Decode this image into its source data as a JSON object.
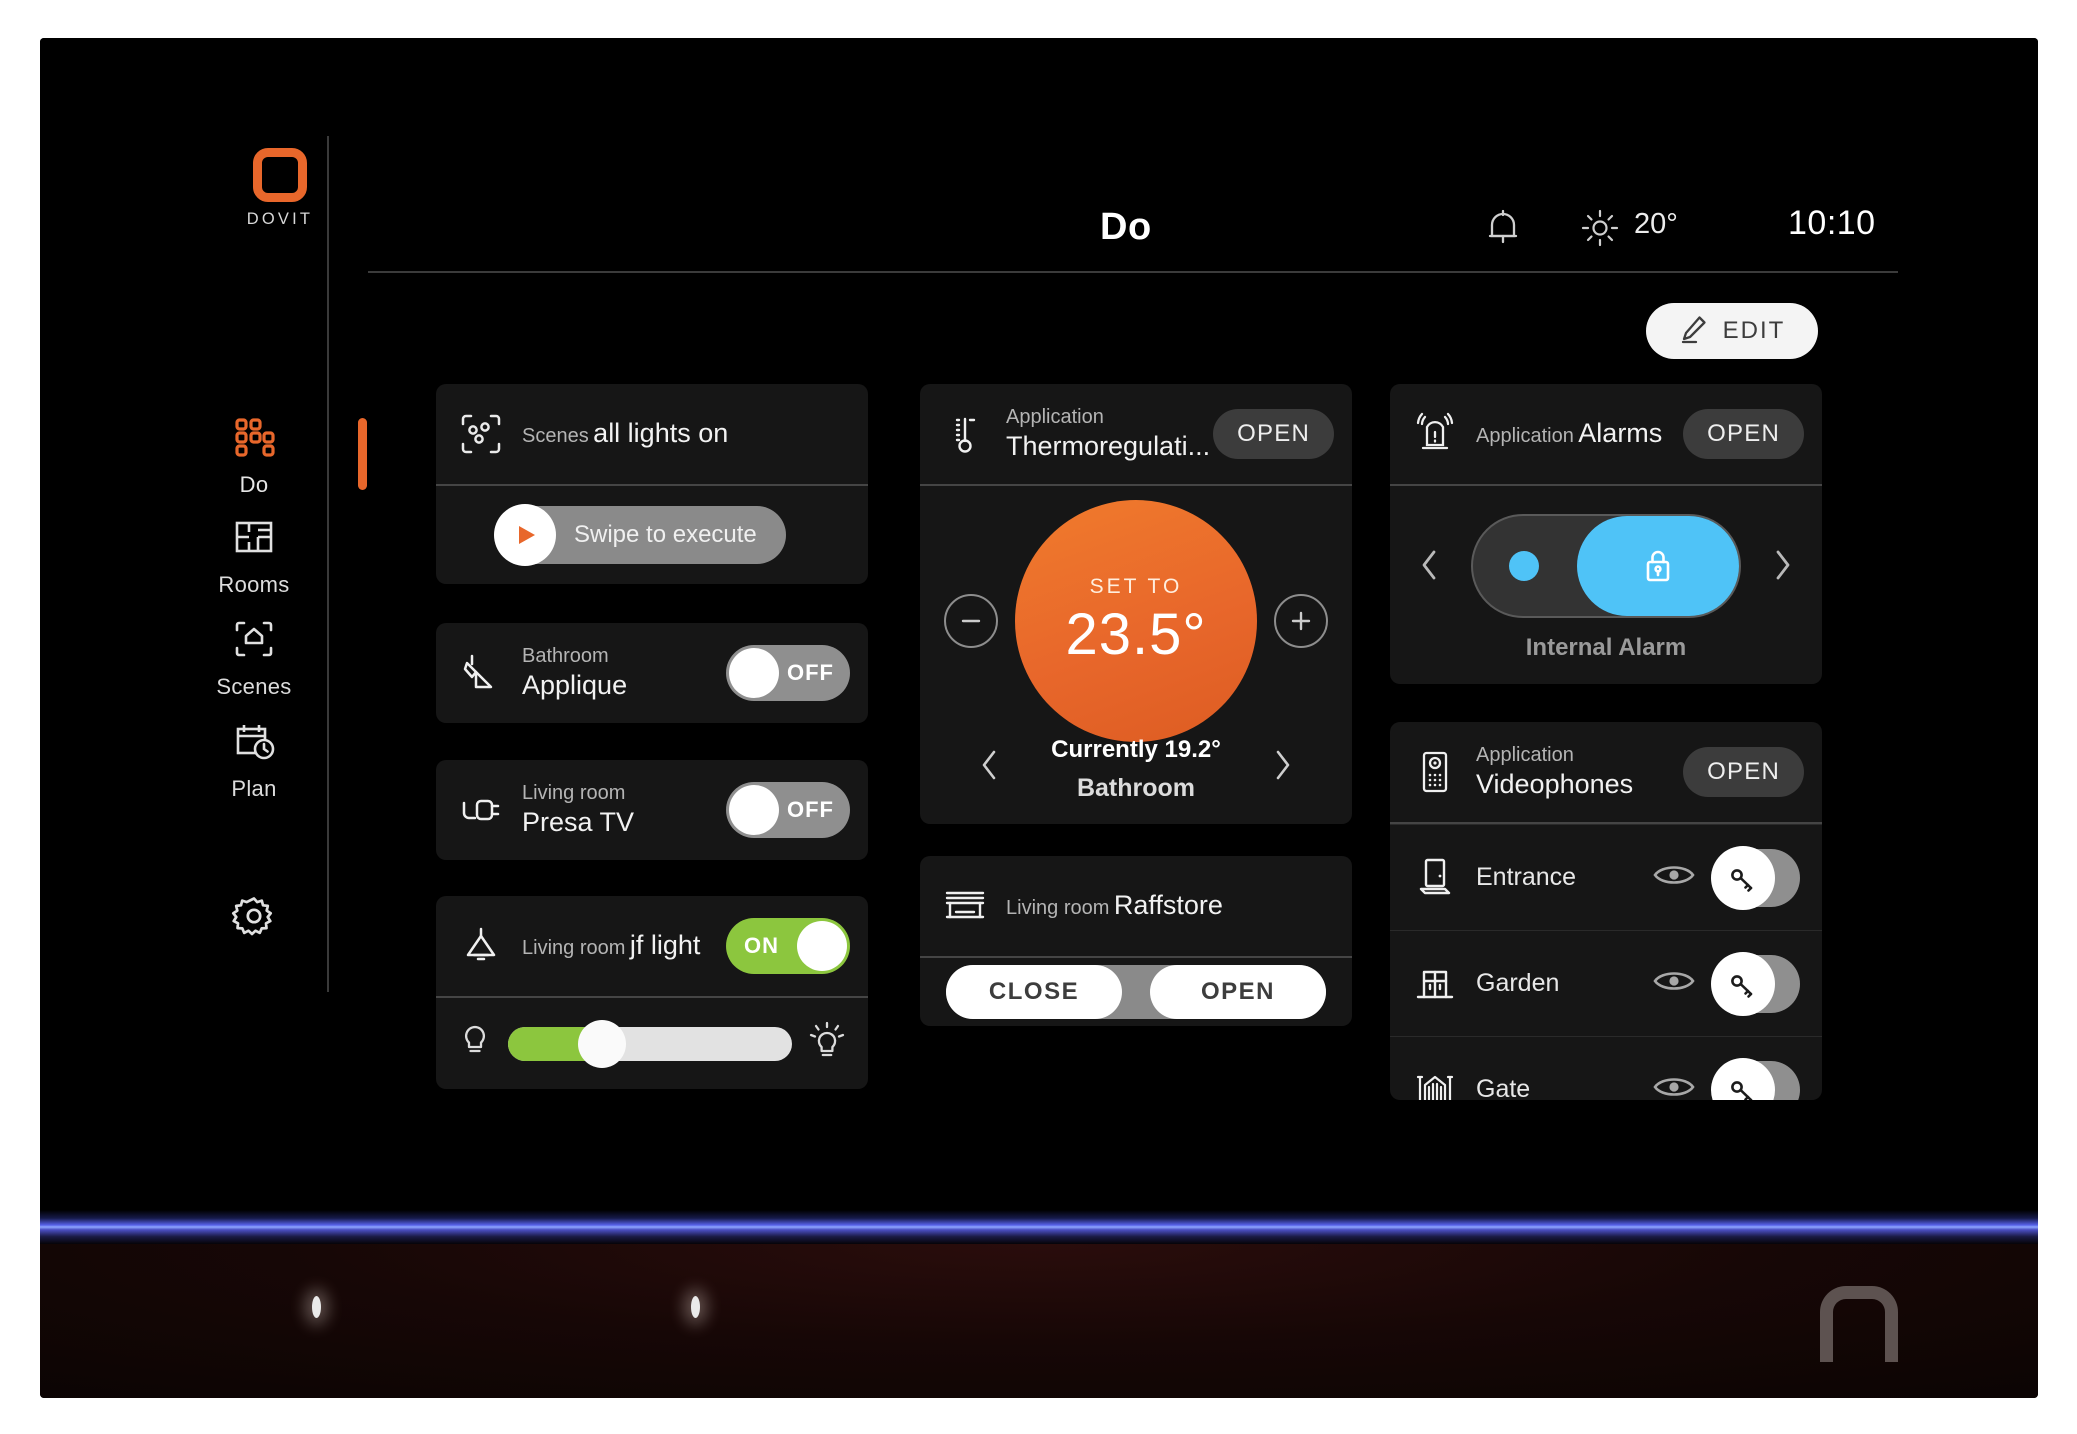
{
  "header": {
    "title": "Do",
    "bell_icon": "bell-icon",
    "weather_icon": "sun-icon",
    "outdoor_temp": "20°",
    "clock": "10:10"
  },
  "logo": {
    "text": "DOVIT",
    "color": "#E8672B"
  },
  "sidebar": {
    "items": [
      {
        "label": "Do",
        "icon": "grid-icon",
        "active": true
      },
      {
        "label": "Rooms",
        "icon": "floorplan-icon",
        "active": false
      },
      {
        "label": "Scenes",
        "icon": "home-frame-icon",
        "active": false
      },
      {
        "label": "Plan",
        "icon": "calendar-clock-icon",
        "active": false
      }
    ],
    "settings": {
      "label": "",
      "icon": "gear-icon"
    }
  },
  "toolbar": {
    "edit_label": "EDIT",
    "edit_icon": "pencil-icon"
  },
  "cards": {
    "scenes": {
      "icon": "scene-scan-icon",
      "subtitle": "Scenes",
      "name": "all lights on",
      "swipe_label": "Swipe to execute",
      "swipe_icon": "play-icon"
    },
    "applique": {
      "icon": "wall-lamp-icon",
      "subtitle": "Bathroom",
      "name": "Applique",
      "toggle_state": "OFF"
    },
    "presa_tv": {
      "icon": "plug-icon",
      "subtitle": "Living room",
      "name": "Presa TV",
      "toggle_state": "OFF"
    },
    "jf_light": {
      "icon": "pendant-lamp-icon",
      "subtitle": "Living room",
      "name": "jf light",
      "toggle_state": "ON",
      "dimmer_percent": 33,
      "dim_icon": "bulb-dim-icon",
      "bright_icon": "bulb-bright-icon"
    },
    "thermoregulation": {
      "icon": "thermometer-icon",
      "subtitle": "Application",
      "name": "Thermoregulati...",
      "open_label": "OPEN",
      "set_label": "SET TO",
      "setpoint": "23.5°",
      "current": "Currently 19.2°",
      "zone": "Bathroom",
      "minus_icon": "minus-circle-icon",
      "plus_icon": "plus-circle-icon",
      "prev_icon": "chevron-left-icon",
      "next_icon": "chevron-right-icon"
    },
    "raffstore": {
      "icon": "blind-icon",
      "subtitle": "Living room",
      "name": "Raffstore",
      "close_label": "CLOSE",
      "open_label": "OPEN"
    },
    "alarms": {
      "icon": "siren-icon",
      "subtitle": "Application",
      "name": "Alarms",
      "open_label": "OPEN",
      "zone_label": "Internal Alarm",
      "lock_icon": "lock-icon",
      "prev_icon": "chevron-left-icon",
      "next_icon": "chevron-right-icon",
      "accent": "#4FC3F7"
    },
    "videophones": {
      "icon": "intercom-icon",
      "subtitle": "Application",
      "name": "Videophones",
      "open_label": "OPEN",
      "rows": [
        {
          "name": "Entrance",
          "icon": "door-icon",
          "eye_icon": "eye-icon",
          "key_icon": "key-icon"
        },
        {
          "name": "Garden",
          "icon": "garden-gate-icon",
          "eye_icon": "eye-icon",
          "key_icon": "key-icon"
        },
        {
          "name": "Gate",
          "icon": "fence-gate-icon",
          "eye_icon": "eye-icon",
          "key_icon": "key-icon"
        }
      ]
    }
  },
  "colors": {
    "accent_orange": "#E8672B",
    "toggle_on_green": "#8CC63E",
    "alarm_blue": "#4FC3F7",
    "card_bg": "#161616",
    "screen_bg": "#000000"
  }
}
